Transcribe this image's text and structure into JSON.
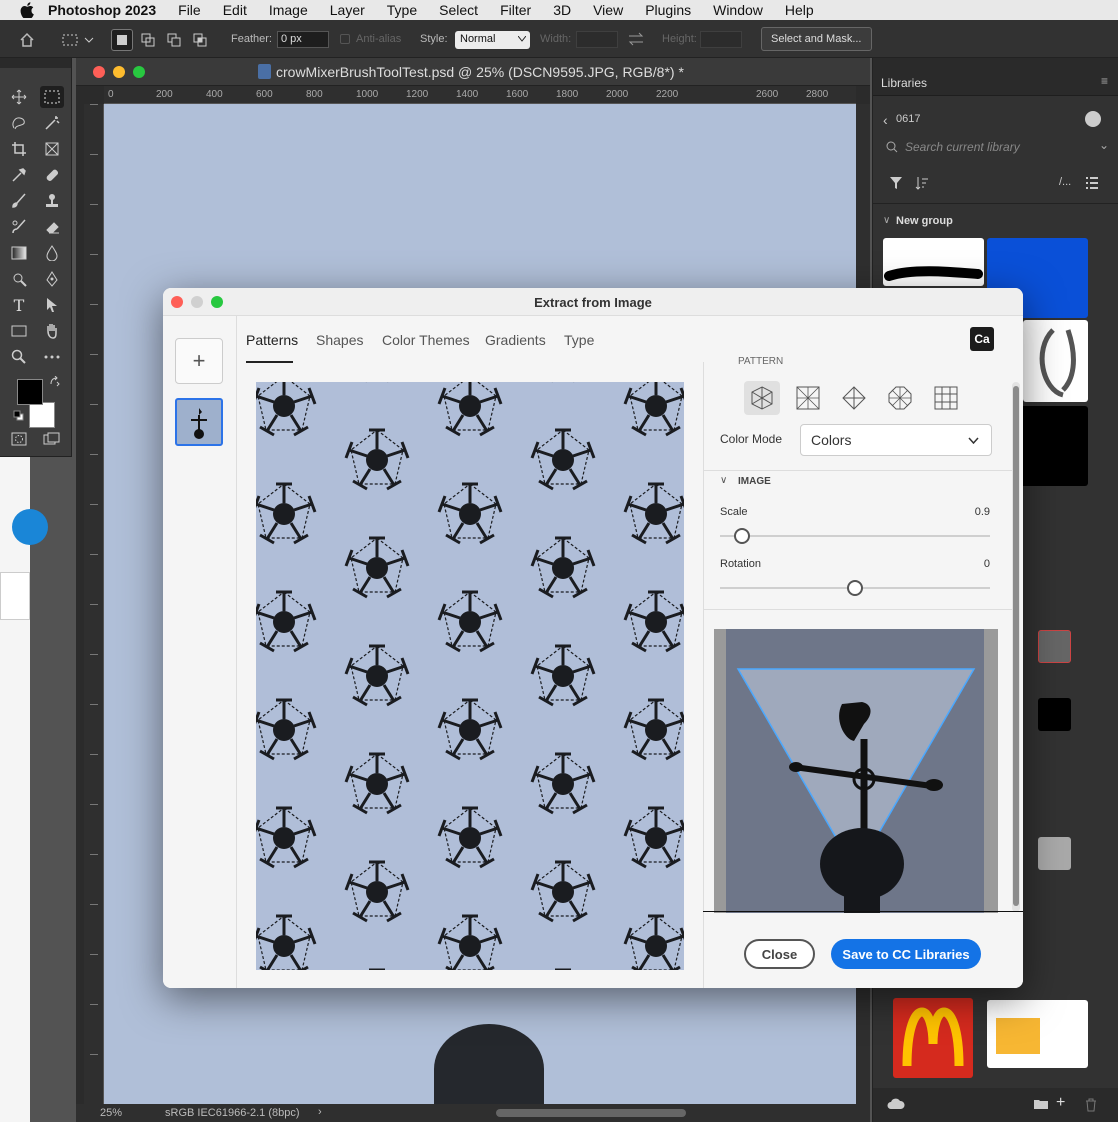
{
  "menubar": {
    "app_name": "Photoshop 2023",
    "items": [
      "File",
      "Edit",
      "Image",
      "Layer",
      "Type",
      "Select",
      "Filter",
      "3D",
      "View",
      "Plugins",
      "Window",
      "Help"
    ]
  },
  "options_bar": {
    "feather_label": "Feather:",
    "feather_value": "0 px",
    "antialias_label": "Anti-alias",
    "style_label": "Style:",
    "style_value": "Normal",
    "width_label": "Width:",
    "height_label": "Height:",
    "select_mask_label": "Select and Mask..."
  },
  "document": {
    "title": "crowMixerBrushToolTest.psd @ 25% (DSCN9595.JPG, RGB/8*) *",
    "ruler_labels": [
      "0",
      "200",
      "400",
      "600",
      "800",
      "1000",
      "1200",
      "1400",
      "1600",
      "1800",
      "2000",
      "2200",
      "2600",
      "2800"
    ],
    "zoom": "25%",
    "color_profile": "sRGB IEC61966-2.1 (8bpc)"
  },
  "libraries": {
    "panel_title": "Libraries",
    "library_name": "0617",
    "search_placeholder": "Search current library",
    "group_name": "New group"
  },
  "dialog": {
    "title": "Extract from Image",
    "tabs": [
      "Patterns",
      "Shapes",
      "Color Themes",
      "Gradients",
      "Type"
    ],
    "active_tab": "Patterns",
    "logo_text": "Ca",
    "section_pattern": "PATTERN",
    "color_mode_label": "Color Mode",
    "color_mode_value": "Colors",
    "section_image": "IMAGE",
    "scale_label": "Scale",
    "scale_value": "0.9",
    "scale_fraction": 0.08,
    "rotation_label": "Rotation",
    "rotation_value": "0",
    "rotation_fraction": 0.5,
    "close_label": "Close",
    "save_label": "Save to CC Libraries"
  },
  "colors": {
    "accent": "#1473e6",
    "canvas_bg": "#b0bfd8",
    "panel_bg": "#323232"
  }
}
